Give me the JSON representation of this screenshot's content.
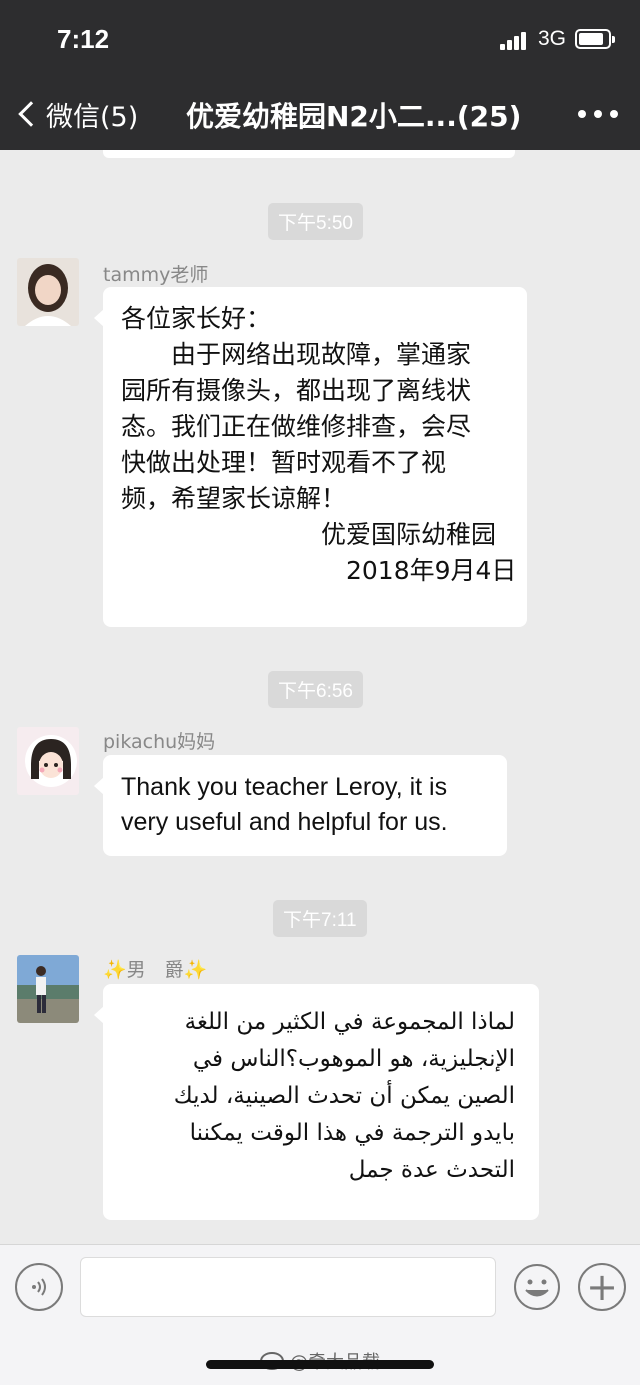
{
  "status_bar": {
    "time": "7:12",
    "network": "3G"
  },
  "nav": {
    "back_label": "微信(5)",
    "title": "优爱幼稚园N2小二...(25)"
  },
  "messages": [
    {
      "timestamp": "下午5:50",
      "sender": "tammy老师",
      "lines": [
        "各位家长好：",
        "　　由于网络出现故障，掌通家",
        "园所有摄像头，都出现了离线状",
        "态。我们正在做维修排查，会尽",
        "快做出处理！暂时观看不了视",
        "频，希望家长谅解！",
        "　　　　　　　　优爱国际幼稚园",
        "　　　　　　　　　2018年9月4日"
      ]
    },
    {
      "timestamp": "下午6:56",
      "sender": "pikachu妈妈",
      "lines": [
        "Thank you teacher Leroy, it is",
        "very useful and helpful for us."
      ]
    },
    {
      "timestamp": "下午7:11",
      "sender": "✨男　爵✨",
      "lines": [
        "لماذا المجموعة في الكثير من اللغة",
        "الإنجليزية، هو الموهوب؟الناس في",
        "الصين يمكن أن تحدث الصينية، لديك",
        "بايدو الترجمة في هذا الوقت يمكننا",
        "التحدث عدة جمل"
      ]
    }
  ],
  "input_bar": {
    "voice_icon": "voice-icon",
    "emoji_icon": "emoji-icon",
    "plus_icon": "plus-icon"
  },
  "watermark": "@牵大品载",
  "colors": {
    "header_bg": "#2d2d2f",
    "chat_bg": "#ebebeb",
    "bubble_bg": "#ffffff",
    "timestamp_bg": "#d9d9d9"
  }
}
